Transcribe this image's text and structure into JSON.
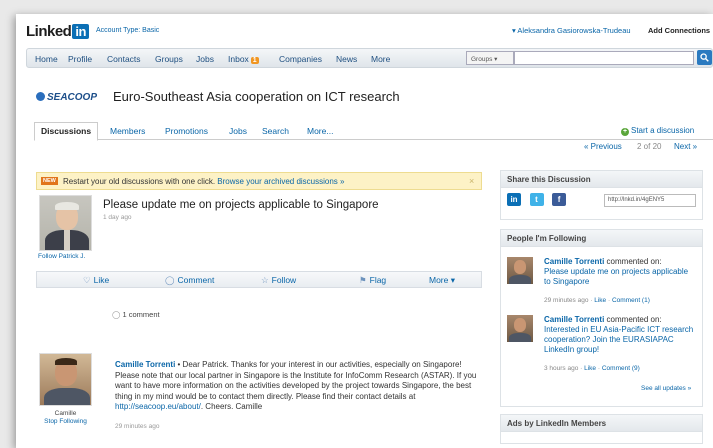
{
  "topbar": {
    "logo_text": "Linked",
    "logo_in": "in",
    "account_type": "Account Type: Basic",
    "user_name": "▾ Aleksandra Gasiorowska-Trudeau",
    "add_connections": "Add Connections"
  },
  "nav": {
    "items": [
      {
        "label": "Home"
      },
      {
        "label": "Profile"
      },
      {
        "label": "Contacts"
      },
      {
        "label": "Groups"
      },
      {
        "label": "Jobs"
      },
      {
        "label": "Inbox"
      },
      {
        "label": "Companies"
      },
      {
        "label": "News"
      },
      {
        "label": "More"
      }
    ],
    "inbox_badge": "1",
    "search_scope": "Groups ▾",
    "search_value": ""
  },
  "group": {
    "logo_text": "SEACOOP",
    "title": "Euro-Southeast Asia cooperation on ICT research"
  },
  "tabs": [
    {
      "label": "Discussions"
    },
    {
      "label": "Members"
    },
    {
      "label": "Promotions"
    },
    {
      "label": "Jobs"
    },
    {
      "label": "Search"
    },
    {
      "label": "More..."
    }
  ],
  "start_discussion": "Start a discussion",
  "pager": {
    "previous": "« Previous",
    "position": "2 of 20",
    "next": "Next »"
  },
  "banner": {
    "badge": "NEW",
    "text": "Restart your old discussions with one click.",
    "link": "Browse your archived discussions »",
    "close": "×"
  },
  "post": {
    "follow_author": "Follow Patrick J.",
    "title": "Please update me on projects applicable to Singapore",
    "time": "1 day ago",
    "actions": {
      "like": "Like",
      "comment": "Comment",
      "follow": "Follow",
      "flag": "Flag",
      "more": "More ▾"
    },
    "comments_count": "1 comment"
  },
  "comment": {
    "author": "Camille Torrenti",
    "author_short": "Camille",
    "stop_following": "Stop Following",
    "text": " • Dear Patrick. Thanks for your interest in our activities, especially on Singapore! Please note that our local partner in Singapore is the Institute for InfoComm Research (ASTAR). If you want to have more information on the activities developed by the project towards Singapore, the best thing in my mind would be to contact them directly. Please find their contact details at ",
    "link": "http://seacoop.eu/about/",
    "text_end": ". Cheers. Camille",
    "time": "29 minutes ago"
  },
  "sidebar": {
    "share_title": "Share this Discussion",
    "share_url": "http://lnkd.in/4gENY5",
    "following_title": "People I'm Following",
    "feed": [
      {
        "name": "Camille Torrenti",
        "action": " commented on:",
        "target": "Please update me on projects applicable to Singapore",
        "time": "29 minutes ago",
        "like": "Like",
        "comments": "Comment (1)"
      },
      {
        "name": "Camille Torrenti",
        "action": " commented on:",
        "target": "Interested in EU Asia-Pacific ICT research cooperation? Join the EURASIAPAC LinkedIn group!",
        "time": "3 hours ago",
        "like": "Like",
        "comments": "Comment (9)"
      }
    ],
    "see_all": "See all updates »",
    "ads_title": "Ads by LinkedIn Members"
  }
}
